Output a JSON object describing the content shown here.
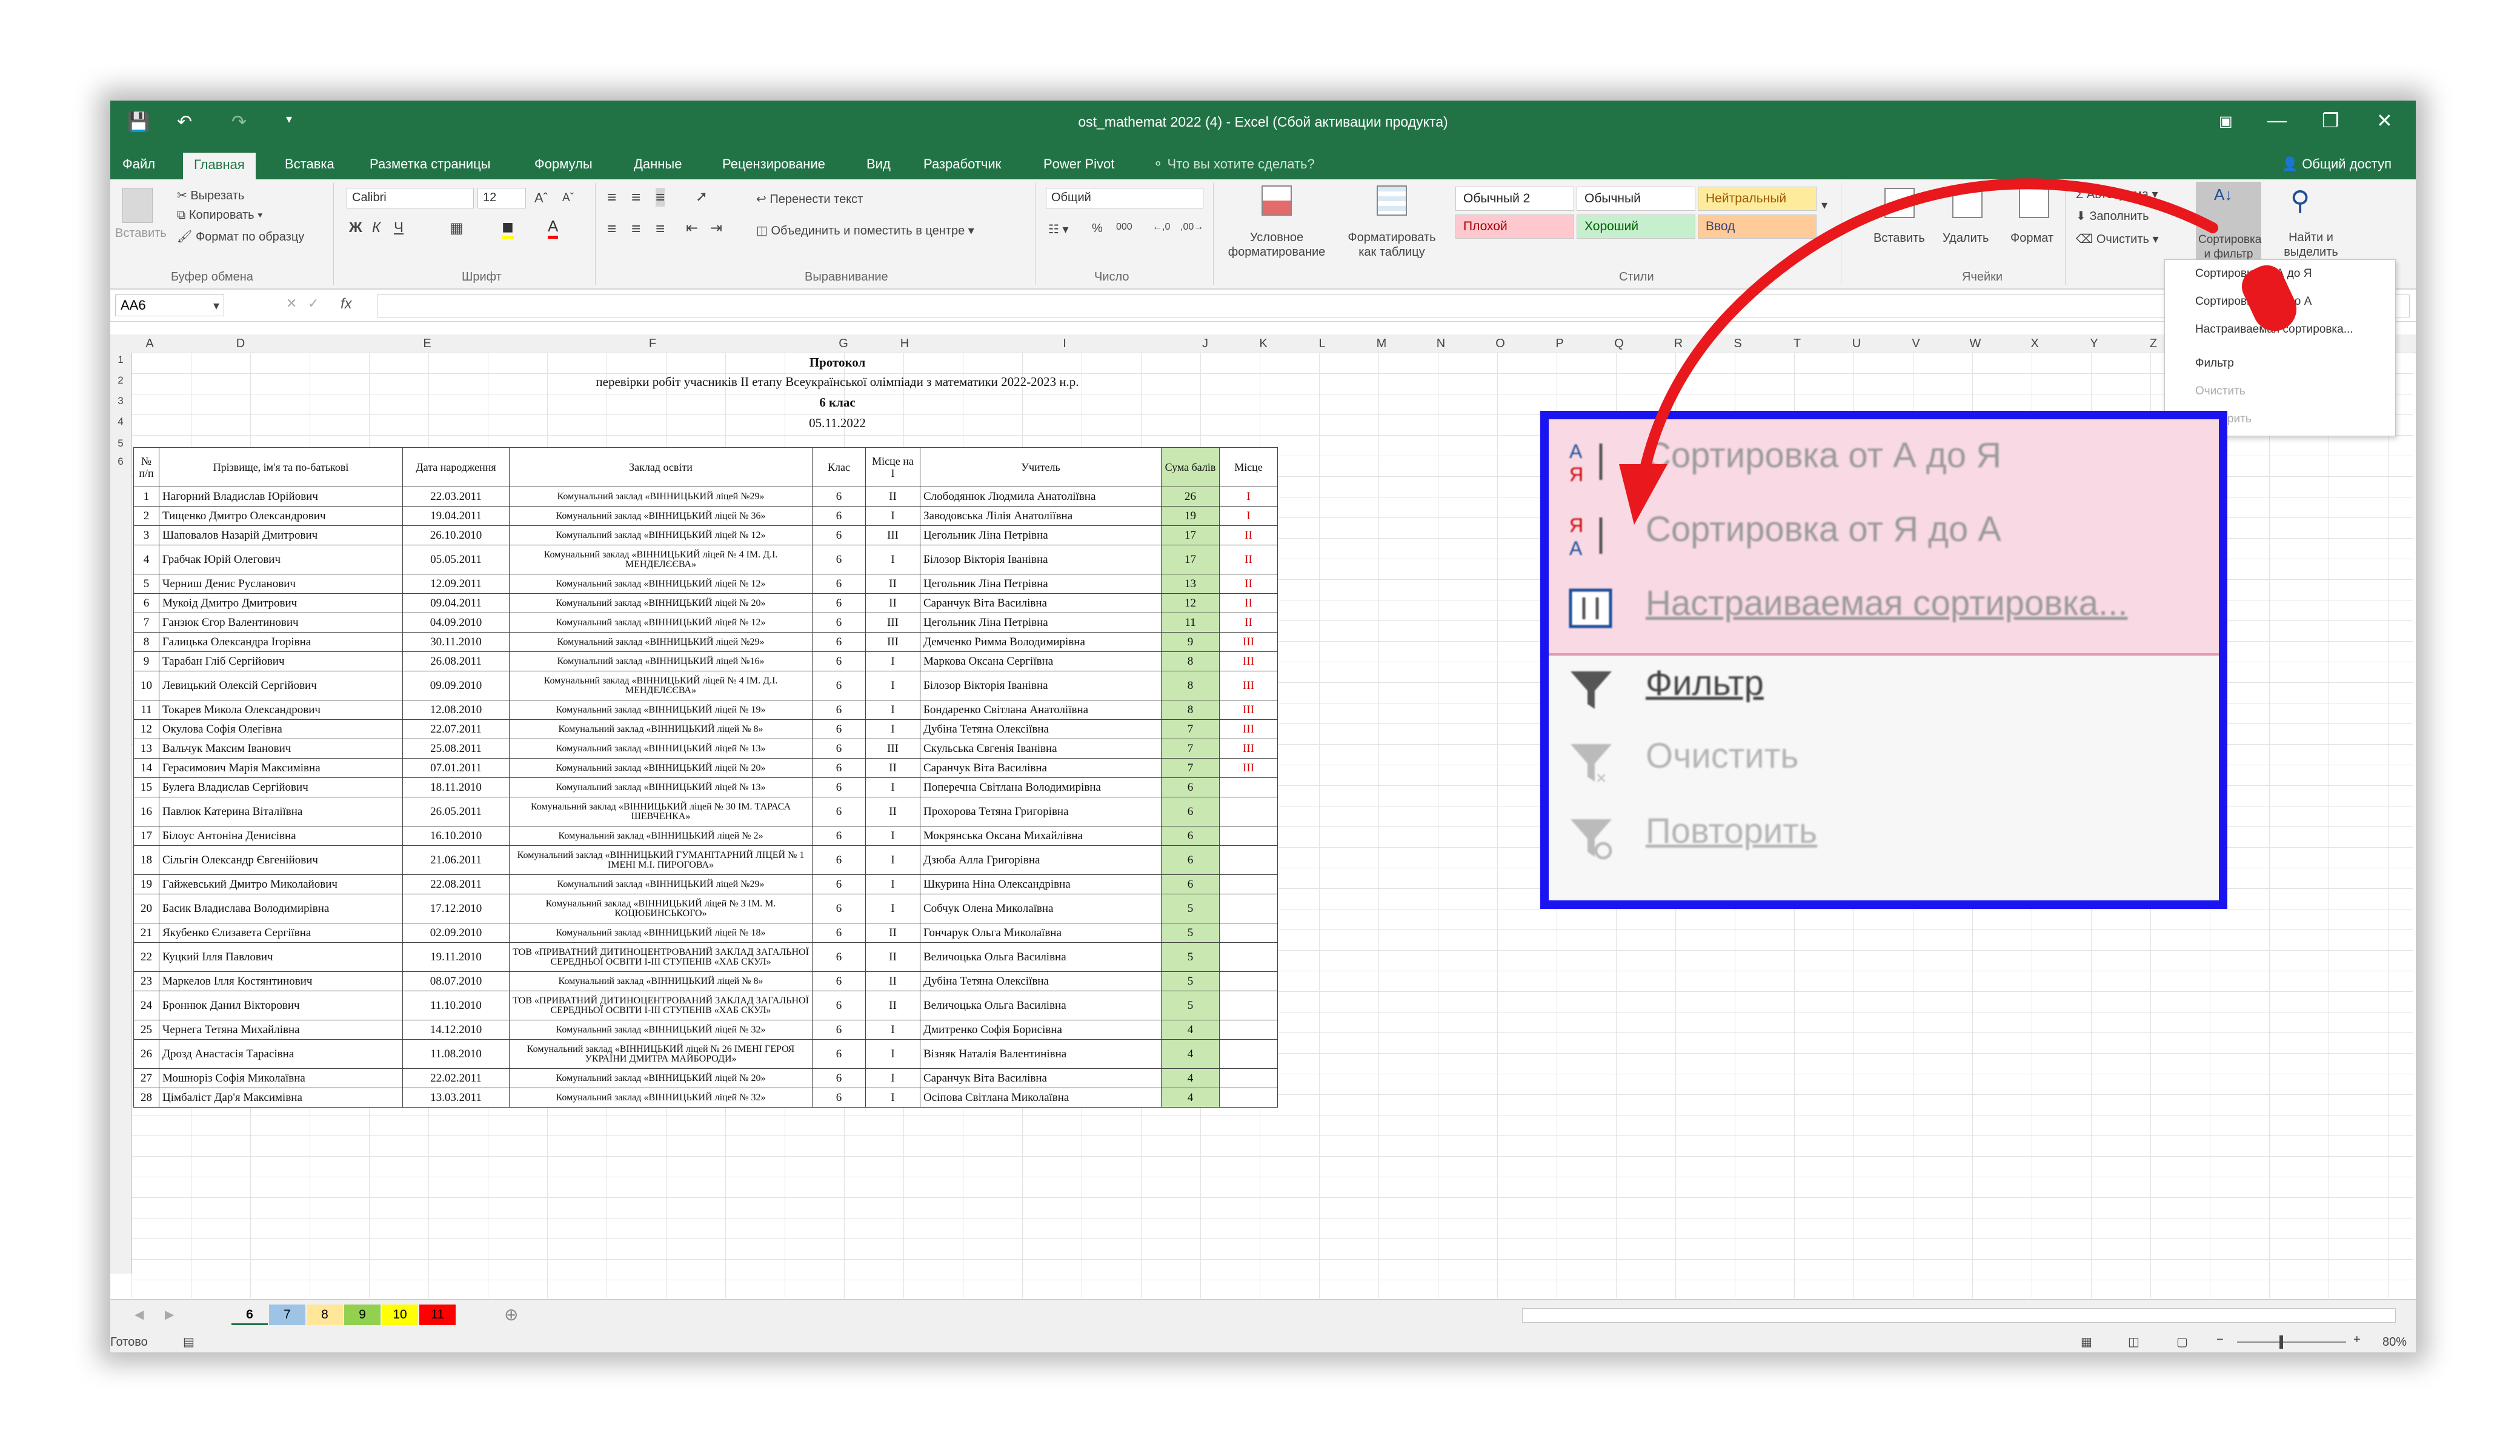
{
  "window": {
    "title": "ost_mathemat 2022 (4) - Excel (Сбой активации продукта)"
  },
  "tabs": [
    "Файл",
    "Главная",
    "Вставка",
    "Разметка страницы",
    "Формулы",
    "Данные",
    "Рецензирование",
    "Вид",
    "Разработчик",
    "Power Pivot"
  ],
  "tell_me": "Что вы хотите сделать?",
  "share": "Общий доступ",
  "ribbon": {
    "paste": "Вставить",
    "cut": "Вырезать",
    "copy": "Копировать",
    "format_painter": "Формат по образцу",
    "clipboard": "Буфер обмена",
    "font_name": "Calibri",
    "font_size": "12",
    "font_group": "Шрифт",
    "wrap_text": "Перенести текст",
    "merge_center": "Объединить и поместить в центре",
    "alignment": "Выравнивание",
    "number_format": "Общий",
    "number_group": "Число",
    "cond_format": "Условное форматирование",
    "format_table": "Форматировать как таблицу",
    "styles": [
      "Обычный 2",
      "Обычный",
      "Нейтральный",
      "Плохой",
      "Хороший",
      "Ввод"
    ],
    "styles_group": "Стили",
    "insert": "Вставить",
    "delete": "Удалить",
    "format": "Формат",
    "cells_group": "Ячейки",
    "autosum": "Автосумма",
    "fill": "Заполнить",
    "clear": "Очистить",
    "sort_filter": "Сортировка и фильтр",
    "find_select": "Найти и выделить"
  },
  "formula": {
    "namebox": "AA6",
    "fx": "fx"
  },
  "columns": [
    "A",
    "D",
    "E",
    "F",
    "G",
    "H",
    "I",
    "J",
    "K",
    "L",
    "M",
    "N",
    "O",
    "P",
    "Q",
    "R",
    "S",
    "T",
    "U",
    "V",
    "W",
    "X",
    "Y",
    "Z"
  ],
  "sheet": {
    "title1": "Протокол",
    "title2": "перевірки робіт учасників ІІ етапу Всеукраїнської олімпіади з математики 2022-2023 н.р.",
    "title3": "6 клас",
    "title4": "05.11.2022",
    "headers": [
      "№ п/п",
      "Прізвище, ім'я та по-батькові",
      "Дата народження",
      "Заклад освіти",
      "Клас",
      "Місце на І",
      "Учитель",
      "Сума балів",
      "Місце"
    ],
    "rows": [
      [
        "1",
        "Нагорний Владислав Юрійович",
        "22.03.2011",
        "Комунальний заклад «ВІННИЦЬКИЙ ліцей №29»",
        "6",
        "II",
        "Слободянюк Людмила Анатоліївна",
        "26",
        "I"
      ],
      [
        "2",
        "Тищенко Дмитро Олександрович",
        "19.04.2011",
        "Комунальний заклад «ВІННИЦЬКИЙ ліцей № 36»",
        "6",
        "I",
        "Заводовська Лілія Анатоліївна",
        "19",
        "I"
      ],
      [
        "3",
        "Шаповалов Назарій Дмитрович",
        "26.10.2010",
        "Комунальний заклад «ВІННИЦЬКИЙ ліцей № 12»",
        "6",
        "III",
        "Цегольник Ліна Петрівна",
        "17",
        "II"
      ],
      [
        "4",
        "Грабчак Юрій Олегович",
        "05.05.2011",
        "Комунальний заклад «ВІННИЦЬКИЙ ліцей № 4 ІМ. Д.І. МЕНДЕЛЄЄВА»",
        "6",
        "I",
        "Білозор Вікторія Іванівна",
        "17",
        "II"
      ],
      [
        "5",
        "Черниш Денис Русланович",
        "12.09.2011",
        "Комунальний заклад «ВІННИЦЬКИЙ ліцей № 12»",
        "6",
        "II",
        "Цегольник Ліна Петрівна",
        "13",
        "II"
      ],
      [
        "6",
        "Мукоід Дмитро Дмитрович",
        "09.04.2011",
        "Комунальний заклад «ВІННИЦЬКИЙ ліцей № 20»",
        "6",
        "II",
        "Саранчук Віта Василівна",
        "12",
        "II"
      ],
      [
        "7",
        "Ганзюк Єгор Валентинович",
        "04.09.2010",
        "Комунальний заклад «ВІННИЦЬКИЙ ліцей № 12»",
        "6",
        "III",
        "Цегольник Ліна Петрівна",
        "11",
        "II"
      ],
      [
        "8",
        "Галицька Олександра Ігорівна",
        "30.11.2010",
        "Комунальний заклад «ВІННИЦЬКИЙ ліцей №29»",
        "6",
        "III",
        "Демченко Римма Володимирівна",
        "9",
        "III"
      ],
      [
        "9",
        "Тарабан Гліб Сергійович",
        "26.08.2011",
        "Комунальний заклад «ВІННИЦЬКИЙ ліцей №16»",
        "6",
        "I",
        "Маркова Оксана Сергіївна",
        "8",
        "III"
      ],
      [
        "10",
        "Левицький Олексій Сергійович",
        "09.09.2010",
        "Комунальний заклад «ВІННИЦЬКИЙ ліцей № 4 ІМ. Д.І. МЕНДЕЛЄЄВА»",
        "6",
        "I",
        "Білозор Вікторія Іванівна",
        "8",
        "III"
      ],
      [
        "11",
        "Токарев Микола Олександрович",
        "12.08.2010",
        "Комунальний заклад «ВІННИЦЬКИЙ ліцей № 19»",
        "6",
        "I",
        "Бондаренко Світлана Анатоліївна",
        "8",
        "III"
      ],
      [
        "12",
        "Окулова Софія Олегівна",
        "22.07.2011",
        "Комунальний заклад «ВІННИЦЬКИЙ ліцей № 8»",
        "6",
        "I",
        "Дубіна Тетяна Олексіївна",
        "7",
        "III"
      ],
      [
        "13",
        "Вальчук Максим Іванович",
        "25.08.2011",
        "Комунальний заклад «ВІННИЦЬКИЙ ліцей № 13»",
        "6",
        "III",
        "Скульська Євгенія Іванівна",
        "7",
        "III"
      ],
      [
        "14",
        "Герасимович Марія Максимівна",
        "07.01.2011",
        "Комунальний заклад «ВІННИЦЬКИЙ ліцей № 20»",
        "6",
        "II",
        "Саранчук Віта Василівна",
        "7",
        "III"
      ],
      [
        "15",
        "Булега Владислав Сергійович",
        "18.11.2010",
        "Комунальний заклад «ВІННИЦЬКИЙ ліцей № 13»",
        "6",
        "I",
        "Поперечна Світлана Володимирівна",
        "6",
        ""
      ],
      [
        "16",
        "Павлюк Катерина Віталіївна",
        "26.05.2011",
        "Комунальний заклад «ВІННИЦЬКИЙ ліцей № 30 ІМ. ТАРАСА ШЕВЧЕНКА»",
        "6",
        "II",
        "Прохорова Тетяна Григорівна",
        "6",
        ""
      ],
      [
        "17",
        "Білоус Антоніна Денисівна",
        "16.10.2010",
        "Комунальний заклад «ВІННИЦЬКИЙ ліцей № 2»",
        "6",
        "I",
        "Мокрянська Оксана Михайлівна",
        "6",
        ""
      ],
      [
        "18",
        "Сільгін Олександр Євгенійович",
        "21.06.2011",
        "Комунальний заклад «ВІННИЦЬКИЙ ГУМАНІТАРНИЙ ЛІЦЕЙ № 1 ІМЕНІ М.І. ПИРОГОВА»",
        "6",
        "I",
        "Дзюба Алла Григорівна",
        "6",
        ""
      ],
      [
        "19",
        "Гайжевський Дмитро Миколайович",
        "22.08.2011",
        "Комунальний заклад «ВІННИЦЬКИЙ ліцей №29»",
        "6",
        "I",
        "Шкурина Ніна Олександрівна",
        "6",
        ""
      ],
      [
        "20",
        "Басик Владислава Володимирівна",
        "17.12.2010",
        "Комунальний заклад «ВІННИЦЬКИЙ ліцей № 3 ІМ. М. КОЦЮБИНСЬКОГО»",
        "6",
        "I",
        "Собчук Олена Миколаївна",
        "5",
        ""
      ],
      [
        "21",
        "Якубенко Єлизавета Сергіївна",
        "02.09.2010",
        "Комунальний заклад «ВІННИЦЬКИЙ ліцей № 18»",
        "6",
        "II",
        "Гончарук Ольга Миколаївна",
        "5",
        ""
      ],
      [
        "22",
        "Куцкий Ілля Павлович",
        "19.11.2010",
        "ТОВ «ПРИВАТНИЙ ДИТИНОЦЕНТРОВАНИЙ ЗАКЛАД ЗАГАЛЬНОЇ СЕРЕДНЬОЇ ОСВІТИ І-ІІІ СТУПЕНІВ «ХАБ СКУЛ»",
        "6",
        "II",
        "Величоцька Ольга Василівна",
        "5",
        ""
      ],
      [
        "23",
        "Маркелов Ілля Костянтинович",
        "08.07.2010",
        "Комунальний заклад «ВІННИЦЬКИЙ ліцей № 8»",
        "6",
        "II",
        "Дубіна Тетяна Олексіївна",
        "5",
        ""
      ],
      [
        "24",
        "Броннюк Данил Вікторович",
        "11.10.2010",
        "ТОВ «ПРИВАТНИЙ ДИТИНОЦЕНТРОВАНИЙ ЗАКЛАД ЗАГАЛЬНОЇ СЕРЕДНЬОЇ ОСВІТИ І-ІІІ СТУПЕНІВ «ХАБ СКУЛ»",
        "6",
        "II",
        "Величоцька Ольга Василівна",
        "5",
        ""
      ],
      [
        "25",
        "Чернега Тетяна Михайлівна",
        "14.12.2010",
        "Комунальний заклад «ВІННИЦЬКИЙ ліцей № 32»",
        "6",
        "I",
        "Дмитренко Софія Борисівна",
        "4",
        ""
      ],
      [
        "26",
        "Дрозд Анастасія Тарасівна",
        "11.08.2010",
        "Комунальний заклад «ВІННИЦЬКИЙ ліцей № 26 ІМЕНІ ГЕРОЯ УКРАЇНИ ДМИТРА МАЙБОРОДИ»",
        "6",
        "I",
        "Візняк Наталія Валентинівна",
        "4",
        ""
      ],
      [
        "27",
        "Мошнорiз Софія Миколаївна",
        "22.02.2011",
        "Комунальний заклад «ВІННИЦЬКИЙ ліцей № 20»",
        "6",
        "I",
        "Саранчук Віта Василівна",
        "4",
        ""
      ],
      [
        "28",
        "Цімбаліст Дар'я Максимівна",
        "13.03.2011",
        "Комунальний заклад «ВІННИЦЬКИЙ ліцей № 32»",
        "6",
        "I",
        "Осіпова Світлана Миколаївна",
        "4",
        ""
      ]
    ]
  },
  "sheet_tabs": [
    {
      "label": "6",
      "color": "#ffffff"
    },
    {
      "label": "7",
      "color": "#9dc3e6"
    },
    {
      "label": "8",
      "color": "#ffe699"
    },
    {
      "label": "9",
      "color": "#92d050"
    },
    {
      "label": "10",
      "color": "#ffff00"
    },
    {
      "label": "11",
      "color": "#ff0000"
    }
  ],
  "status": {
    "ready": "Готово",
    "zoom": "80%"
  },
  "dropdown_small": [
    "Сортировка от А до Я",
    "Сортировка от Я до А",
    "Настраиваемая сортировка...",
    "Фильтр",
    "Очистить",
    "Повторить"
  ],
  "zoom_menu": {
    "sort_az": "Сортировка от А до Я",
    "sort_za": "Сортировка от Я до А",
    "custom_sort": "Настраиваемая сортировка...",
    "filter": "Фильтр",
    "clear": "Очистить",
    "reapply": "Повторить"
  },
  "colors": {
    "excel_green": "#217346",
    "highlight_blue": "#1a14f0",
    "arrow_red": "#e8181c",
    "score_green": "#c9e7b1"
  }
}
